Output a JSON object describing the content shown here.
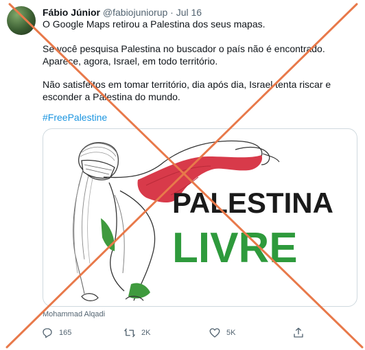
{
  "tweet": {
    "author_name": "Fábio Júnior",
    "handle": "@fabiojuniorup",
    "separator": "·",
    "date": "Jul 16",
    "paragraph_1": "O Google Maps retirou a Palestina dos seus mapas.",
    "paragraph_2": "Se você pesquisa Palestina no buscador o país não é encontrado. Aparece, agora, Israel, em todo território.",
    "paragraph_3": "Não satisfeitos em tomar território, dia após dia, Israel tenta riscar e esconder a Palestina do mundo.",
    "hashtag": "#FreePalestine"
  },
  "media": {
    "line_1": "PALESTINA",
    "line_2": "LIVRE",
    "caption": "Mohammad Alqadi"
  },
  "actions": {
    "reply_count": "165",
    "retweet_count": "2K",
    "like_count": "5K"
  },
  "overlay": {
    "cross_color": "#e8794a"
  },
  "icons": [
    "reply-icon",
    "retweet-icon",
    "like-icon",
    "share-icon"
  ]
}
